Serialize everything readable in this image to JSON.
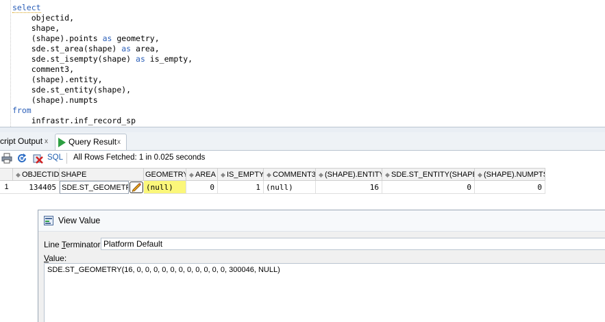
{
  "editor": {
    "lines": [
      {
        "kw": "select",
        "text": ""
      },
      {
        "kw": "",
        "text": "    objectid,"
      },
      {
        "kw": "",
        "text": "    shape,"
      },
      {
        "kw": "",
        "text": "    (shape).points ",
        "kw2": "as",
        "text2": " geometry,"
      },
      {
        "kw": "",
        "text": "    sde.st_area(shape) ",
        "kw2": "as",
        "text2": " area,"
      },
      {
        "kw": "",
        "text": "    sde.st_isempty(shape) ",
        "kw2": "as",
        "text2": " is_empty,"
      },
      {
        "kw": "",
        "text": "    comment3,"
      },
      {
        "kw": "",
        "text": "    (shape).entity,"
      },
      {
        "kw": "",
        "text": "    sde.st_entity(shape),"
      },
      {
        "kw": "",
        "text": "    (shape).numpts"
      },
      {
        "kw": "from",
        "text": ""
      },
      {
        "kw": "",
        "text": "    infrastr.inf_record_sp"
      }
    ]
  },
  "tabs": {
    "script_output": "cript Output",
    "query_result": "Query Result",
    "close": "x"
  },
  "toolbar": {
    "sql_label": "SQL",
    "status": "All Rows Fetched: 1 in 0.025 seconds",
    "icons": [
      "print-icon",
      "refresh-icon",
      "rollback-icon"
    ]
  },
  "grid": {
    "columns": [
      "OBJECTID",
      "SHAPE",
      "GEOMETRY",
      "AREA",
      "IS_EMPTY",
      "COMMENT3",
      "(SHAPE).ENTITY",
      "SDE.ST_ENTITY(SHAPE)",
      "(SHAPE).NUMPTS"
    ],
    "rows": [
      {
        "rownum": "1",
        "cells": [
          "134405",
          "SDE.ST_GEOMETRY(",
          "(null)",
          "0",
          "1",
          "(null)",
          "16",
          "0",
          "0"
        ]
      }
    ]
  },
  "dialog": {
    "title": "View Value",
    "line_terminator_label_pre": "Line ",
    "line_terminator_label_ul": "T",
    "line_terminator_label_post": "erminator:",
    "line_terminator_value": "Platform Default",
    "value_label_ul": "V",
    "value_label_post": "alue:",
    "value_text": "SDE.ST_GEOMETRY(16, 0, 0, 0, 0, 0, 0, 0, 0, 0, 0, 0, 300046, NULL)"
  },
  "colors": {
    "keyword": "#2b5fb8",
    "highlight": "#fbf77a",
    "run_green": "#2ea043"
  }
}
